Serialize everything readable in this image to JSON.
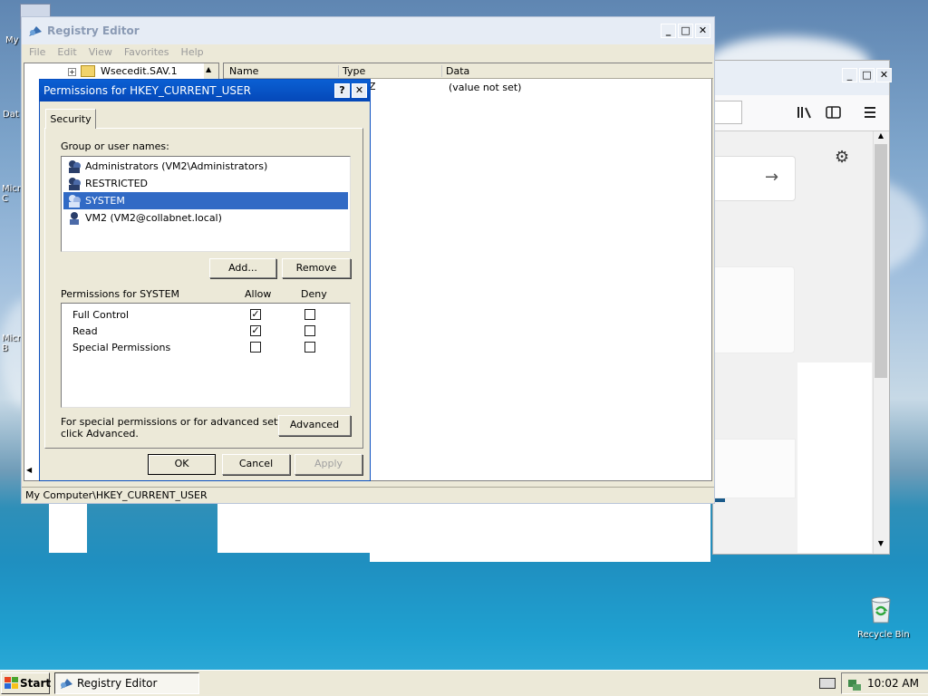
{
  "desktop": {
    "icon_labels": [
      "My",
      "Dat",
      "Micro C",
      "Micro B"
    ],
    "recycle_bin_label": "Recycle Bin"
  },
  "registry_editor": {
    "title": "Registry Editor",
    "menu": [
      "File",
      "Edit",
      "View",
      "Favorites",
      "Help"
    ],
    "tree_item": "Wsecedit.SAV.1",
    "columns": {
      "name": "Name",
      "type": "Type",
      "data": "Data"
    },
    "rows": [
      {
        "name": "",
        "type": "Z",
        "data": "(value not set)"
      }
    ],
    "status_path": "My Computer\\HKEY_CURRENT_USER"
  },
  "browser": {
    "toolbar_icons": [
      "library-icon",
      "sidebar-icon",
      "menu-icon"
    ],
    "arrow_glyph": "→",
    "gear_glyph": "⚙"
  },
  "permissions_dialog": {
    "title": "Permissions for HKEY_CURRENT_USER",
    "title_buttons": [
      "?",
      "✕"
    ],
    "tab": "Security",
    "group_label": "Group or user names:",
    "users": [
      "Administrators (VM2\\Administrators)",
      "RESTRICTED",
      "SYSTEM",
      "VM2 (VM2@collabnet.local)"
    ],
    "selected_user_index": 2,
    "add_button": "Add...",
    "remove_button": "Remove",
    "permissions_label": "Permissions for SYSTEM",
    "allow_header": "Allow",
    "deny_header": "Deny",
    "permissions": [
      {
        "name": "Full Control",
        "allow": true,
        "deny": false
      },
      {
        "name": "Read",
        "allow": true,
        "deny": false
      },
      {
        "name": "Special Permissions",
        "allow": false,
        "deny": false
      }
    ],
    "advanced_note_line1": "For special permissions or for advanced settings,",
    "advanced_note_line2": "click Advanced.",
    "advanced_button": "Advanced",
    "ok_button": "OK",
    "cancel_button": "Cancel",
    "apply_button": "Apply"
  },
  "taskbar": {
    "start_label": "Start",
    "task_label": "Registry Editor",
    "clock": "10:02 AM"
  }
}
